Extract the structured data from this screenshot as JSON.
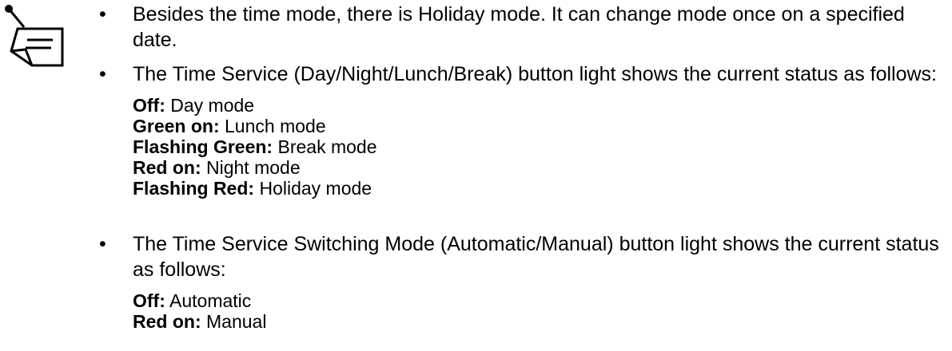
{
  "icon": "note-pad-with-pin-icon",
  "notes": [
    {
      "text": "Besides the time mode, there is Holiday mode. It can change mode once on a specified date.",
      "statuses": []
    },
    {
      "text": "The Time Service (Day/Night/Lunch/Break) button light shows the current status as follows:",
      "statuses": [
        {
          "term": "Off:",
          "value": "Day mode"
        },
        {
          "term": "Green on:",
          "value": "Lunch mode"
        },
        {
          "term": "Flashing Green:",
          "value": "Break mode"
        },
        {
          "term": "Red on:",
          "value": "Night mode"
        },
        {
          "term": "Flashing Red:",
          "value": "Holiday mode"
        }
      ]
    },
    {
      "text": "The Time Service Switching Mode (Automatic/Manual) button light shows the current status as follows:",
      "statuses": [
        {
          "term": "Off:",
          "value": "Automatic"
        },
        {
          "term": "Red on:",
          "value": "Manual"
        }
      ]
    }
  ]
}
